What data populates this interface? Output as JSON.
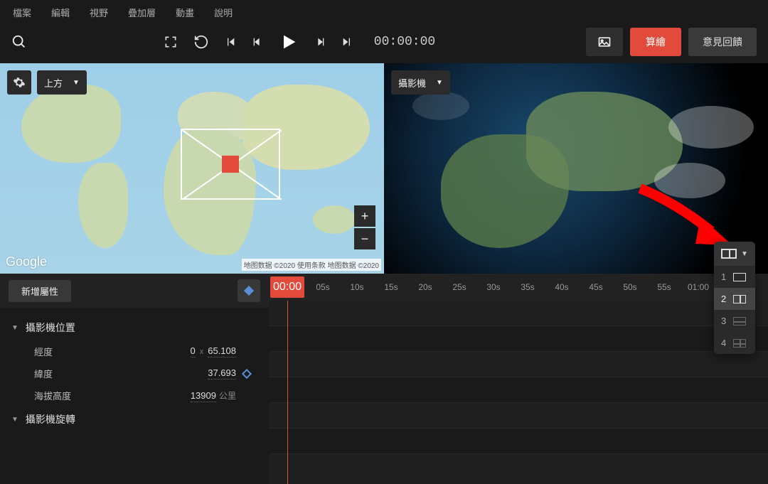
{
  "menu": [
    "檔案",
    "編輯",
    "視野",
    "疊加層",
    "動畫",
    "說明"
  ],
  "timecode": "00:00:00",
  "buttons": {
    "render": "算繪",
    "feedback": "意見回饋"
  },
  "left_view": {
    "dropdown": "上方",
    "logo": "Google",
    "attrib": "地图数据 ©2020  使用条款  地图数据 ©2020"
  },
  "right_view": {
    "dropdown": "攝影機"
  },
  "props": {
    "add_btn": "新增屬性",
    "group_position": "攝影機位置",
    "longitude": {
      "label": "經度",
      "prefix": "0",
      "value": "65.108"
    },
    "latitude": {
      "label": "緯度",
      "value": "37.693"
    },
    "altitude": {
      "label": "海拔高度",
      "value": "13909",
      "unit": "公里"
    },
    "group_rotation": "攝影機旋轉"
  },
  "timeline": {
    "start": "00:00",
    "ticks": [
      "05s",
      "10s",
      "15s",
      "20s",
      "25s",
      "30s",
      "35s",
      "40s",
      "45s",
      "50s",
      "55s",
      "01:00"
    ]
  },
  "layout_options": [
    "1",
    "2",
    "3",
    "4"
  ]
}
